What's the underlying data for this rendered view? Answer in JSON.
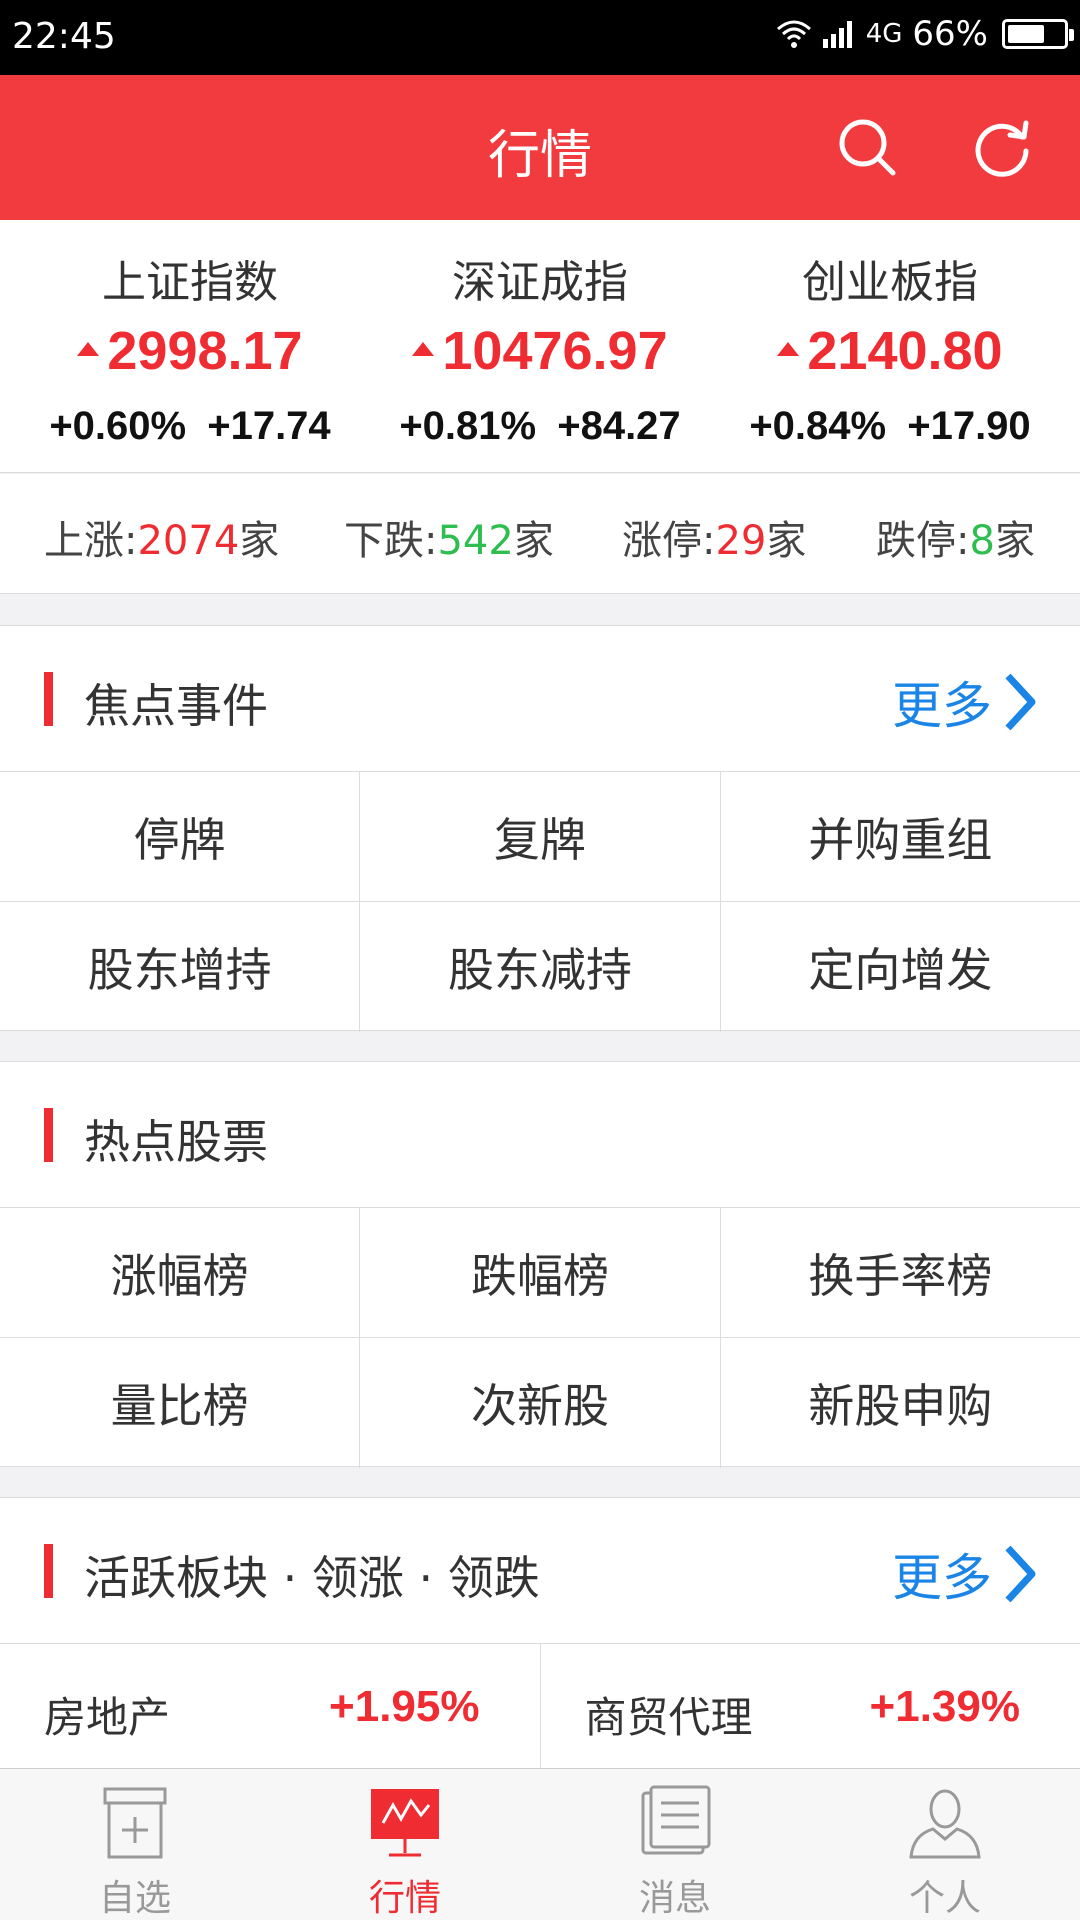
{
  "status_bar": {
    "time": "22:45",
    "network": "4G",
    "battery": "66%",
    "battery_level": 0.66
  },
  "header": {
    "title": "行情"
  },
  "indices": [
    {
      "name": "上证指数",
      "value": "2998.17",
      "change_pct": "+0.60%",
      "change": "+17.74"
    },
    {
      "name": "深证成指",
      "value": "10476.97",
      "change_pct": "+0.81%",
      "change": "+84.27"
    },
    {
      "name": "创业板指",
      "value": "2140.80",
      "change_pct": "+0.84%",
      "change": "+17.90"
    }
  ],
  "breadth": [
    {
      "label": "上涨:",
      "count": "2074",
      "unit": "家",
      "color": "#ef2c32"
    },
    {
      "label": "下跌:",
      "count": "542",
      "unit": "家",
      "color": "#2ebd4f"
    },
    {
      "label": "涨停:",
      "count": "29",
      "unit": "家",
      "color": "#ef2c32"
    },
    {
      "label": "跌停:",
      "count": "8",
      "unit": "家",
      "color": "#2ebd4f"
    }
  ],
  "focus_events": {
    "title": "焦点事件",
    "more": "更多",
    "items": [
      "停牌",
      "复牌",
      "并购重组",
      "股东增持",
      "股东减持",
      "定向增发"
    ]
  },
  "hot_stocks": {
    "title": "热点股票",
    "items": [
      "涨幅榜",
      "跌幅榜",
      "换手率榜",
      "量比榜",
      "次新股",
      "新股申购"
    ]
  },
  "active_sectors": {
    "title": "活跃板块 · 领涨 · 领跌",
    "more": "更多",
    "items": [
      {
        "name": "房地产",
        "pct": "+1.95%"
      },
      {
        "name": "商贸代理",
        "pct": "+1.39%"
      }
    ]
  },
  "tabs": [
    {
      "label": "自选",
      "icon": "watchlist-icon"
    },
    {
      "label": "行情",
      "icon": "market-icon",
      "active": true
    },
    {
      "label": "消息",
      "icon": "news-icon"
    },
    {
      "label": "个人",
      "icon": "person-icon"
    }
  ],
  "colors": {
    "accent": "#f23b3f",
    "up": "#ef2c32",
    "down": "#2ebd4f",
    "link": "#1a85e6"
  }
}
